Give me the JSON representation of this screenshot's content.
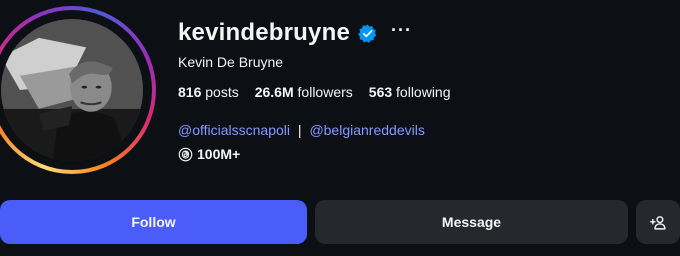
{
  "profile": {
    "username": "kevindebruyne",
    "verified_icon": "verified-badge-icon",
    "more_icon": "more-options-icon",
    "more_label": "···",
    "full_name": "Kevin De Bruyne",
    "avatar_icon": "profile-photo",
    "ring_colors": [
      "#feda75",
      "#fa7e1e",
      "#d62976",
      "#962fbf",
      "#4f5bd5"
    ]
  },
  "stats": {
    "posts_count": "816",
    "posts_label": "posts",
    "followers_count": "26.6M",
    "followers_label": "followers",
    "following_count": "563",
    "following_label": "following"
  },
  "bio": {
    "link1": "@officialsscnapoli",
    "separator": "|",
    "link2": "@belgianreddevils",
    "threads_icon": "threads-icon",
    "threads_label": "100M+"
  },
  "actions": {
    "follow_label": "Follow",
    "message_label": "Message",
    "suggest_icon": "add-person-icon"
  },
  "colors": {
    "background": "#0c1014",
    "accent": "#4a5df9",
    "link": "#8698ff",
    "secondary_button": "#25292e",
    "verified": "#0095f6"
  }
}
